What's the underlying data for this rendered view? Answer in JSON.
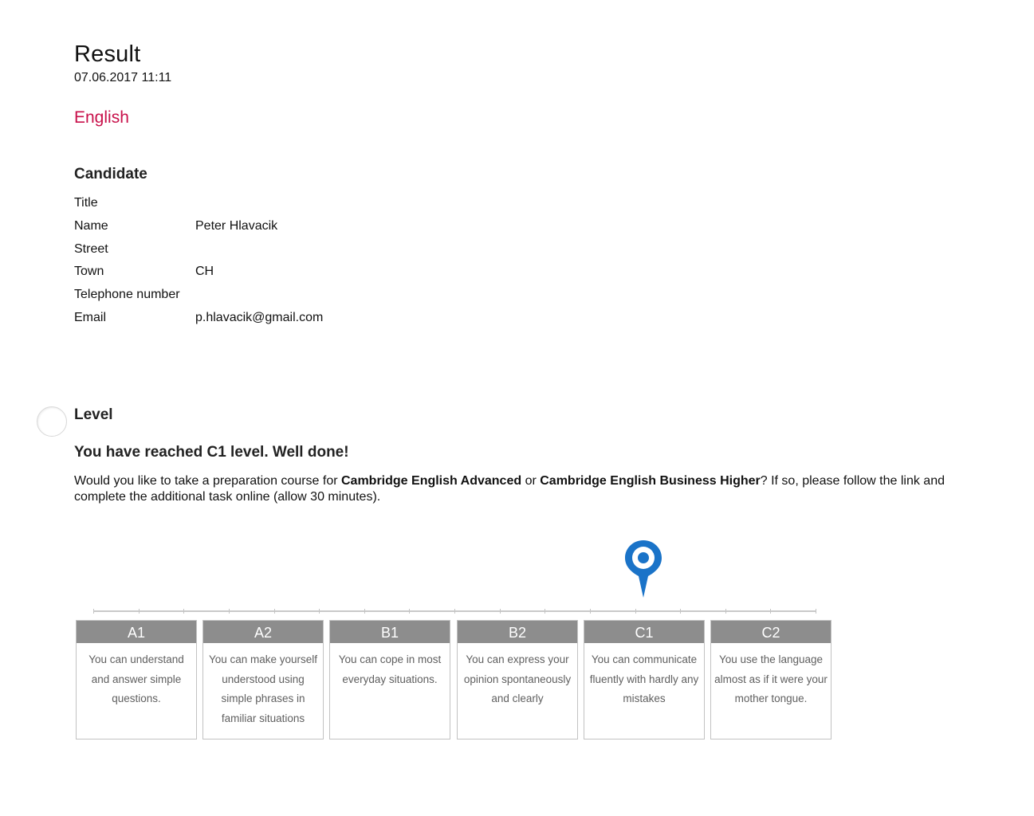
{
  "header": {
    "title": "Result",
    "date": "07.06.2017 11:11",
    "subject": "English",
    "subject_color": "#c8104a"
  },
  "candidate": {
    "heading": "Candidate",
    "fields": [
      {
        "label": "Title",
        "value": ""
      },
      {
        "label": "Name",
        "value": "Peter Hlavacik"
      },
      {
        "label": "Street",
        "value": ""
      },
      {
        "label": "Town",
        "value": "CH"
      },
      {
        "label": "Telephone number",
        "value": ""
      },
      {
        "label": "Email",
        "value": "p.hlavacik@gmail.com"
      }
    ]
  },
  "level": {
    "heading": "Level",
    "reached": "You have reached C1 level. Well done!",
    "course_text": {
      "part1": "Would you like to take a preparation course for ",
      "bold1": "Cambridge English Advanced",
      "part2": " or ",
      "bold2": "Cambridge English Business Higher",
      "part3": "? If so, please follow the link and complete the additional task online (allow 30 minutes)."
    },
    "current_level": "C1",
    "marker_color": "#1a73c8",
    "marker_icon": "map-pin-icon",
    "scale": [
      {
        "code": "A1",
        "desc": "You can understand and answer simple questions."
      },
      {
        "code": "A2",
        "desc": "You can make yourself understood using simple phrases in familiar situations"
      },
      {
        "code": "B1",
        "desc": "You can cope in most everyday situations."
      },
      {
        "code": "B2",
        "desc": "You can express your opinion spontaneously and clearly"
      },
      {
        "code": "C1",
        "desc": "You can communicate fluently with hardly any mistakes"
      },
      {
        "code": "C2",
        "desc": "You use the language almost as if it were your mother tongue."
      }
    ]
  }
}
